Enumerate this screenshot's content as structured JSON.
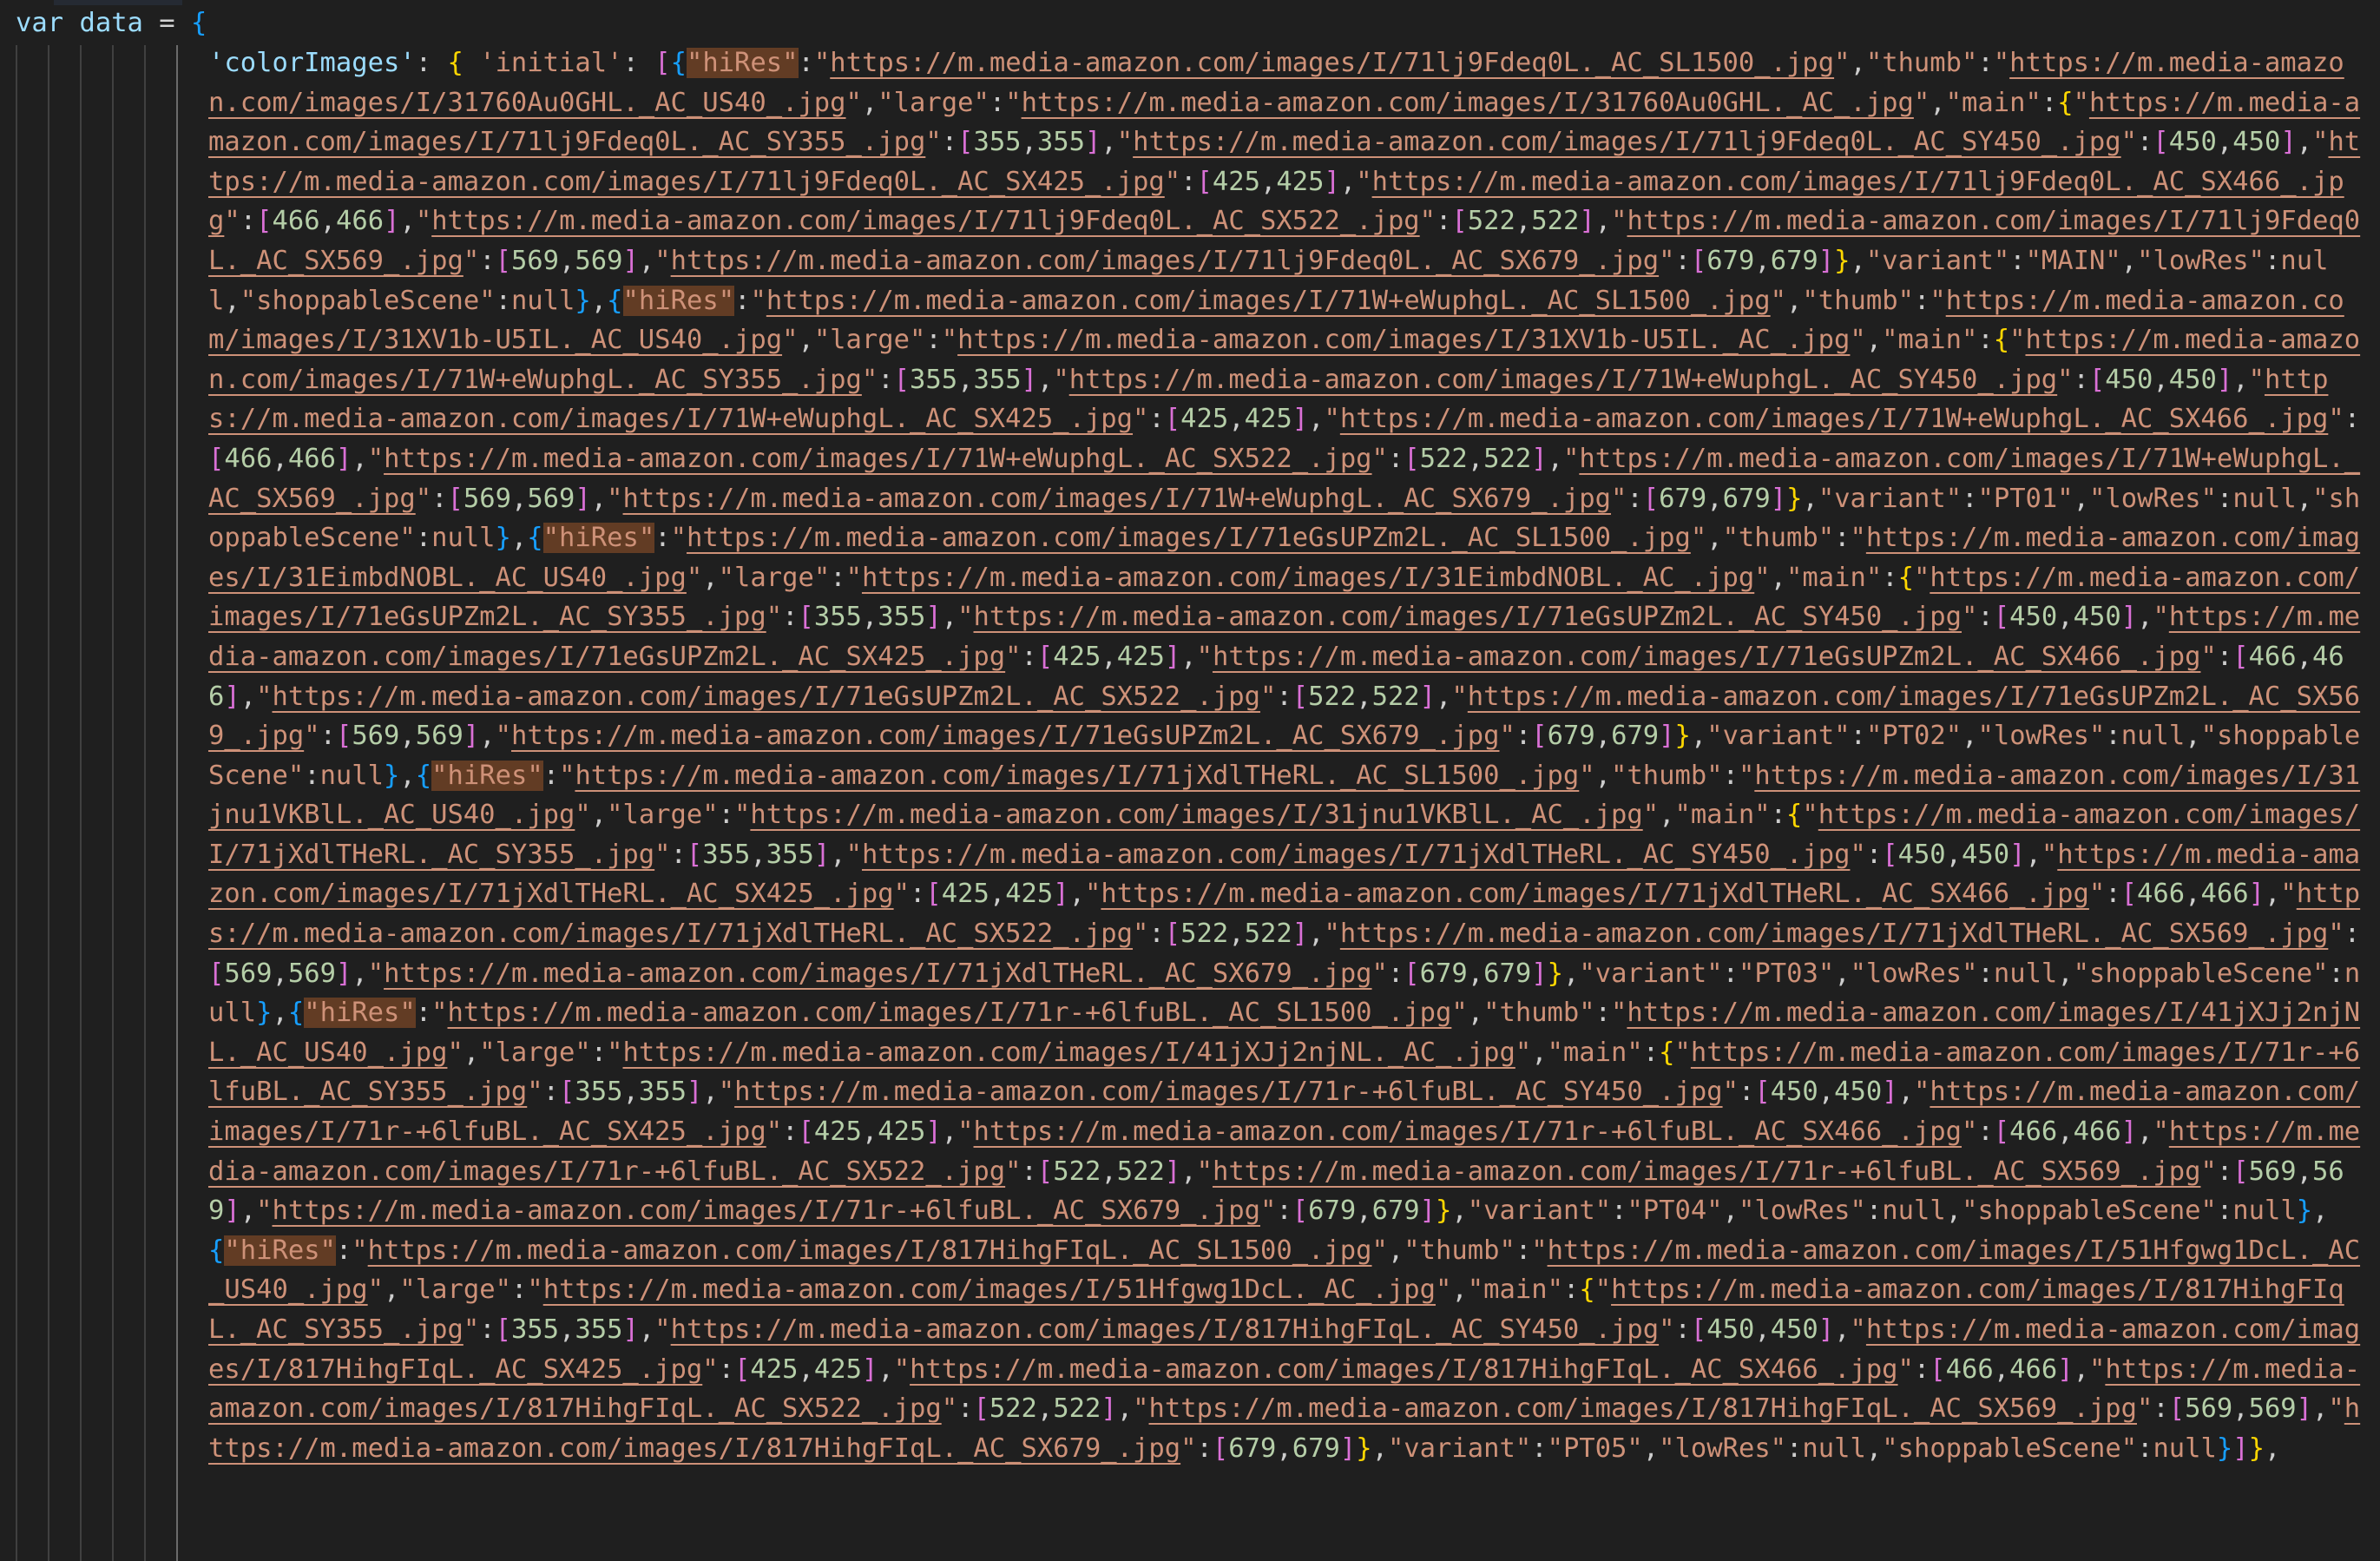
{
  "editor": {
    "declaration": {
      "keyword": "var",
      "identifier": "data",
      "operator": "="
    },
    "object_key": "'colorImages'",
    "inner_key": "'initial'",
    "highlighted_token": "\"hiRes\"",
    "url_prefix": "https://m.media-amazon.com/images/I/",
    "main_sizes": [
      {
        "suffix": "_AC_SY355_.jpg",
        "dims": [
          355,
          355
        ]
      },
      {
        "suffix": "_AC_SY450_.jpg",
        "dims": [
          450,
          450
        ]
      },
      {
        "suffix": "_AC_SX425_.jpg",
        "dims": [
          425,
          425
        ]
      },
      {
        "suffix": "_AC_SX466_.jpg",
        "dims": [
          466,
          466
        ]
      },
      {
        "suffix": "_AC_SX522_.jpg",
        "dims": [
          522,
          522
        ]
      },
      {
        "suffix": "_AC_SX569_.jpg",
        "dims": [
          569,
          569
        ]
      },
      {
        "suffix": "_AC_SX679_.jpg",
        "dims": [
          679,
          679
        ]
      }
    ],
    "images": [
      {
        "hiRes_id": "71lj9Fdeq0L.",
        "hiRes_suffix": "_AC_SL1500_.jpg",
        "thumb_id": "31760Au0GHL.",
        "thumb_suffix": "_AC_US40_.jpg",
        "large_suffix": "_AC_.jpg",
        "variant": "MAIN",
        "lowRes": "null",
        "shoppableScene": "null"
      },
      {
        "hiRes_id": "71W+eWuphgL.",
        "hiRes_suffix": "_AC_SL1500_.jpg",
        "thumb_id": "31XV1b-U5IL.",
        "thumb_suffix": "_AC_US40_.jpg",
        "large_suffix": "_AC_.jpg",
        "variant": "PT01",
        "lowRes": "null",
        "shoppableScene": "null"
      },
      {
        "hiRes_id": "71eGsUPZm2L.",
        "hiRes_suffix": "_AC_SL1500_.jpg",
        "thumb_id": "31EimbdNOBL.",
        "thumb_suffix": "_AC_US40_.jpg",
        "large_suffix": "_AC_.jpg",
        "variant": "PT02",
        "lowRes": "null",
        "shoppableScene": "null"
      },
      {
        "hiRes_id": "71jXdlTHeRL.",
        "hiRes_suffix": "_AC_SL1500_.jpg",
        "thumb_id": "31jnu1VKBlL.",
        "thumb_suffix": "_AC_US40_.jpg",
        "large_suffix": "_AC_.jpg",
        "variant": "PT03",
        "lowRes": "null",
        "shoppableScene": "null"
      },
      {
        "hiRes_id": "71r-+6lfuBL.",
        "hiRes_suffix": "_AC_SL1500_.jpg",
        "thumb_id": "41jXJj2njNL.",
        "thumb_suffix": "_AC_US40_.jpg",
        "large_suffix": "_AC_.jpg",
        "variant": "PT04",
        "lowRes": "null",
        "shoppableScene": "null"
      },
      {
        "hiRes_id": "817HihgFIqL.",
        "hiRes_suffix": "_AC_SL1500_.jpg",
        "thumb_id": "51Hfgwg1DcL.",
        "thumb_suffix": "_AC_US40_.jpg",
        "large_suffix": "_AC_.jpg",
        "variant": "PT05",
        "lowRes": "null",
        "shoppableScene": "null"
      }
    ],
    "keys": {
      "hiRes": "hiRes",
      "thumb": "thumb",
      "large": "large",
      "main": "main",
      "variant": "variant",
      "lowRes": "lowRes",
      "shoppableScene": "shoppableScene"
    }
  }
}
